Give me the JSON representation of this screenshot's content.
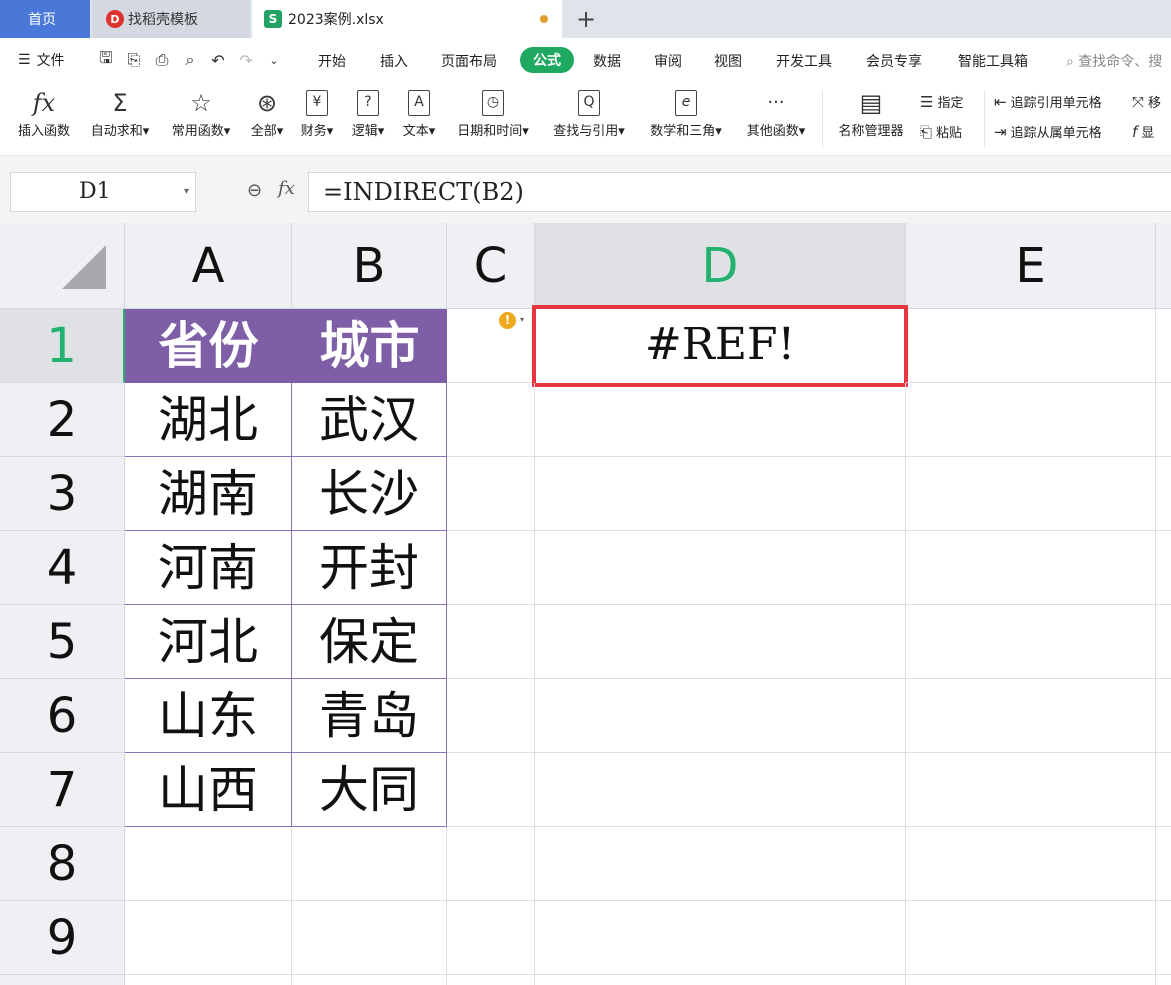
{
  "tabs": {
    "home": "首页",
    "template": "找稻壳模板",
    "file": "2023案例.xlsx",
    "add": "+"
  },
  "menu": {
    "file": "文件",
    "items": [
      "开始",
      "插入",
      "页面布局",
      "公式",
      "数据",
      "审阅",
      "视图",
      "开发工具",
      "会员专享",
      "智能工具箱"
    ],
    "active": "公式",
    "search": "查找命令、搜"
  },
  "ribbon": {
    "buttons": [
      {
        "icon": "fx",
        "label": "插入函数"
      },
      {
        "icon": "Σ",
        "label": "自动求和▾"
      },
      {
        "icon": "☆",
        "label": "常用函数▾"
      },
      {
        "icon": "⊛",
        "label": "全部▾"
      },
      {
        "icon": "¥",
        "label": "财务▾"
      },
      {
        "icon": "?",
        "label": "逻辑▾"
      },
      {
        "icon": "A",
        "label": "文本▾"
      },
      {
        "icon": "◷",
        "label": "日期和时间▾"
      },
      {
        "icon": "Q",
        "label": "查找与引用▾"
      },
      {
        "icon": "e",
        "label": "数学和三角▾"
      },
      {
        "icon": "···",
        "label": "其他函数▾"
      },
      {
        "icon": "▤",
        "label": "名称管理器"
      }
    ],
    "small": {
      "specify": "指定",
      "paste": "粘贴",
      "trace_precedents": "追踪引用单元格",
      "trace_dependents": "追踪从属单元格",
      "move": "移",
      "show": "显"
    }
  },
  "formula": {
    "name_box": "D1",
    "content": "=INDIRECT(B2)"
  },
  "sheet": {
    "columns": [
      "A",
      "B",
      "C",
      "D",
      "E"
    ],
    "selected_column": "D",
    "rows": [
      "1",
      "2",
      "3",
      "4",
      "5",
      "6",
      "7",
      "8",
      "9"
    ],
    "selected_row": "1",
    "header": {
      "a": "省份",
      "b": "城市"
    },
    "data": [
      {
        "a": "湖北",
        "b": "武汉"
      },
      {
        "a": "湖南",
        "b": "长沙"
      },
      {
        "a": "河南",
        "b": "开封"
      },
      {
        "a": "河北",
        "b": "保定"
      },
      {
        "a": "山东",
        "b": "青岛"
      },
      {
        "a": "山西",
        "b": "大同"
      }
    ],
    "d1": "#REF!",
    "warning": "!"
  },
  "colors": {
    "accent": "#1fa85f",
    "header_fill": "#7e5ea6",
    "highlight": "#e4373f"
  }
}
